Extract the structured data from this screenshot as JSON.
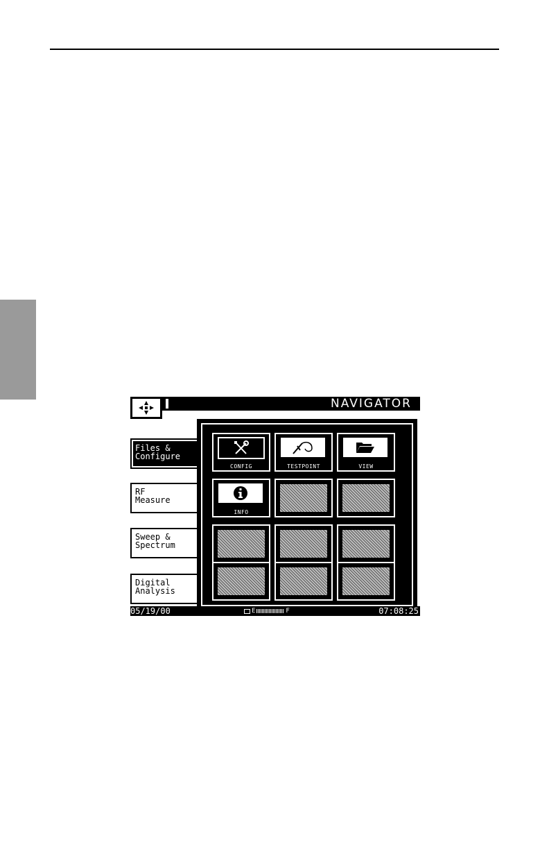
{
  "window": {
    "title": "NAVIGATOR"
  },
  "categories": [
    {
      "line1": "Files &",
      "line2": "Configure",
      "active": true
    },
    {
      "line1": "RF",
      "line2": "Measure",
      "active": false
    },
    {
      "line1": "Sweep &",
      "line2": "Spectrum",
      "active": false
    },
    {
      "line1": "Digital",
      "line2": "Analysis",
      "active": false
    }
  ],
  "tiles": [
    {
      "label": "CONFIG",
      "icon": "wrench-screwdriver-icon"
    },
    {
      "label": "TESTPOINT",
      "icon": "probe-icon"
    },
    {
      "label": "VIEW",
      "icon": "open-folder-icon"
    },
    {
      "label": "INFO",
      "icon": "info-icon"
    }
  ],
  "status": {
    "date": "05/19/00",
    "battery_empty": "E",
    "battery_full": "F",
    "time": "07:08:25"
  }
}
